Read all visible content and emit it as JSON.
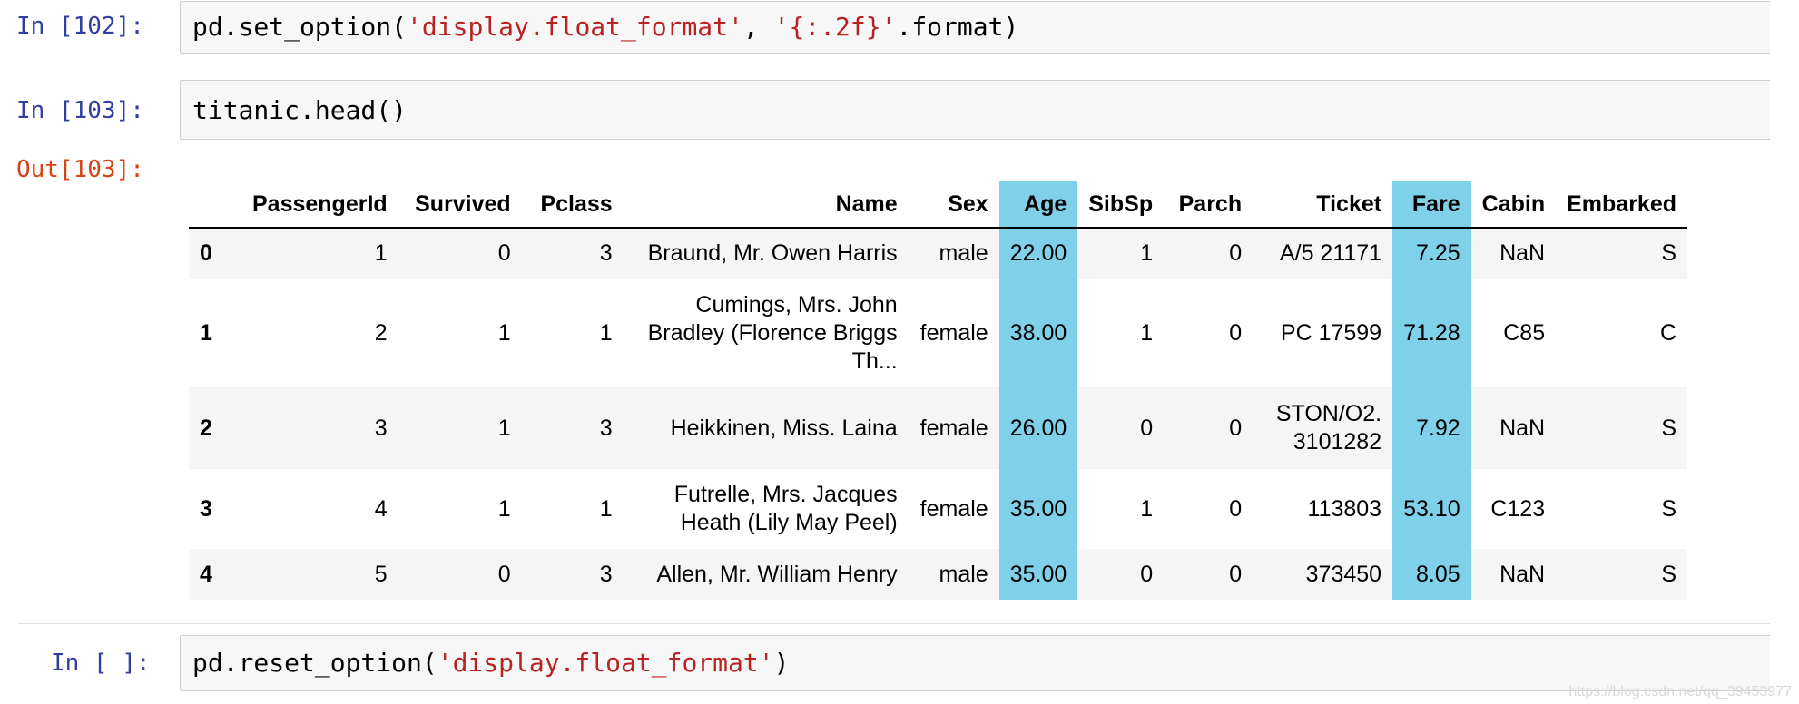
{
  "cells": {
    "c102": {
      "prompt": "In [102]:",
      "code_func": "pd.set_option(",
      "code_str1": "'display.float_format'",
      "code_mid": ", ",
      "code_str2": "'{:.2f}'",
      "code_end": ".format)"
    },
    "c103": {
      "prompt": "In [103]:",
      "code": "titanic.head()",
      "out_prompt": "Out[103]:"
    },
    "cnext": {
      "prompt": "In [ ]:",
      "code_func": "pd.reset_option(",
      "code_str": "'display.float_format'",
      "code_end": ")"
    }
  },
  "dataframe": {
    "columns": [
      "",
      "PassengerId",
      "Survived",
      "Pclass",
      "Name",
      "Sex",
      "Age",
      "SibSp",
      "Parch",
      "Ticket",
      "Fare",
      "Cabin",
      "Embarked"
    ],
    "highlighted_columns": [
      "Age",
      "Fare"
    ],
    "highlight_color": "#7fd1ea",
    "rows": [
      [
        "0",
        "1",
        "0",
        "3",
        "Braund, Mr. Owen Harris",
        "male",
        "22.00",
        "1",
        "0",
        "A/5 21171",
        "7.25",
        "NaN",
        "S"
      ],
      [
        "1",
        "2",
        "1",
        "1",
        "Cumings, Mrs. John Bradley (Florence Briggs Th...",
        "female",
        "38.00",
        "1",
        "0",
        "PC 17599",
        "71.28",
        "C85",
        "C"
      ],
      [
        "2",
        "3",
        "1",
        "3",
        "Heikkinen, Miss. Laina",
        "female",
        "26.00",
        "0",
        "0",
        "STON/O2. 3101282",
        "7.92",
        "NaN",
        "S"
      ],
      [
        "3",
        "4",
        "1",
        "1",
        "Futrelle, Mrs. Jacques Heath (Lily May Peel)",
        "female",
        "35.00",
        "1",
        "0",
        "113803",
        "53.10",
        "C123",
        "S"
      ],
      [
        "4",
        "5",
        "0",
        "3",
        "Allen, Mr. William Henry",
        "male",
        "35.00",
        "0",
        "0",
        "373450",
        "8.05",
        "NaN",
        "S"
      ]
    ]
  },
  "watermark": "https://blog.csdn.net/qq_39453977"
}
